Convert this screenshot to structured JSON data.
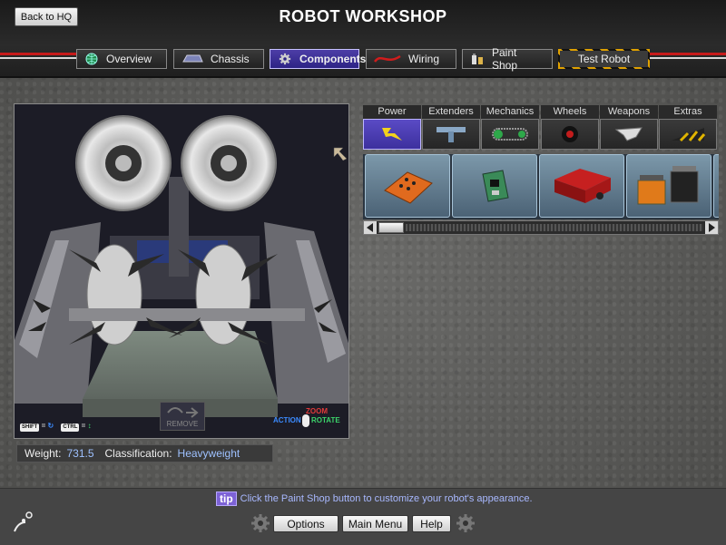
{
  "header": {
    "title": "ROBOT WORKSHOP",
    "back_label": "Back to HQ",
    "tabs": [
      {
        "label": "Overview",
        "icon": "globe-icon"
      },
      {
        "label": "Chassis",
        "icon": "chassis-icon"
      },
      {
        "label": "Components",
        "icon": "gear-icon",
        "active": true
      },
      {
        "label": "Wiring",
        "icon": "wire-icon"
      },
      {
        "label": "Paint Shop",
        "icon": "paint-icon"
      },
      {
        "label": "Test Robot",
        "icon": "hazard-stripe"
      }
    ]
  },
  "viewport": {
    "remove_label": "REMOVE",
    "shift_key": "SHIFT",
    "ctrl_key": "CTRL",
    "action_label": "ACTION",
    "zoom_label": "ZOOM",
    "rotate_label": "ROTATE"
  },
  "stats": {
    "weight_label": "Weight:",
    "weight_value": "731.5",
    "class_label": "Classification:",
    "class_value": "Heavyweight"
  },
  "components": {
    "categories": [
      {
        "label": "Power",
        "icon": "lightning-icon",
        "active": true
      },
      {
        "label": "Extenders",
        "icon": "extender-icon"
      },
      {
        "label": "Mechanics",
        "icon": "chain-icon"
      },
      {
        "label": "Wheels",
        "icon": "wheel-icon"
      },
      {
        "label": "Weapons",
        "icon": "blade-icon"
      },
      {
        "label": "Extras",
        "icon": "hazard-wedge-icon"
      }
    ],
    "items": [
      {
        "name": "orange-battery-pack"
      },
      {
        "name": "green-circuit-board"
      },
      {
        "name": "red-battery-box"
      },
      {
        "name": "dual-battery-set"
      }
    ]
  },
  "footer": {
    "tip_badge": "tip",
    "tip_text": "Click the Paint Shop button to customize your robot's appearance.",
    "options_label": "Options",
    "main_menu_label": "Main Menu",
    "help_label": "Help"
  },
  "colors": {
    "accent": "#4d3ea7",
    "tip_text": "#a8b8ff",
    "stat_value": "#9ec1ff"
  }
}
